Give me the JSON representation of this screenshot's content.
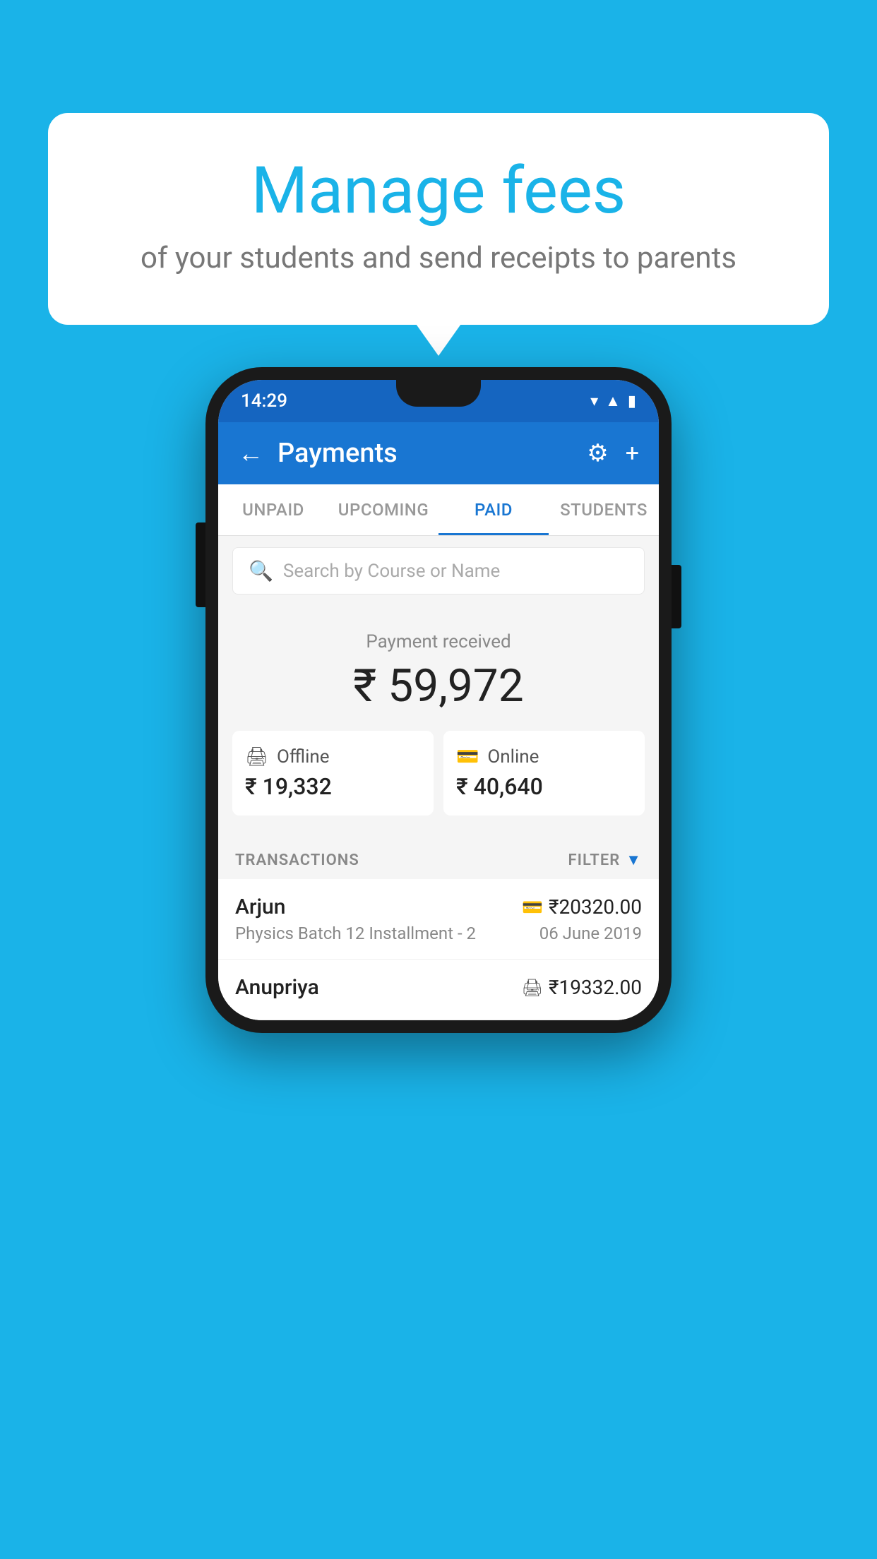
{
  "background_color": "#1ab3e8",
  "bubble": {
    "title": "Manage fees",
    "subtitle": "of your students and send receipts to parents"
  },
  "status_bar": {
    "time": "14:29",
    "icons": [
      "wifi",
      "signal",
      "battery"
    ]
  },
  "header": {
    "title": "Payments",
    "back_label": "←",
    "settings_label": "⚙",
    "add_label": "+"
  },
  "tabs": [
    {
      "label": "UNPAID",
      "active": false
    },
    {
      "label": "UPCOMING",
      "active": false
    },
    {
      "label": "PAID",
      "active": true
    },
    {
      "label": "STUDENTS",
      "active": false
    }
  ],
  "search": {
    "placeholder": "Search by Course or Name"
  },
  "payment_summary": {
    "label": "Payment received",
    "total": "₹ 59,972",
    "offline": {
      "type": "Offline",
      "amount": "₹ 19,332"
    },
    "online": {
      "type": "Online",
      "amount": "₹ 40,640"
    }
  },
  "transactions_header": {
    "label": "TRANSACTIONS",
    "filter_label": "FILTER"
  },
  "transactions": [
    {
      "name": "Arjun",
      "course": "Physics Batch 12 Installment - 2",
      "amount": "₹20320.00",
      "date": "06 June 2019",
      "payment_type": "online"
    },
    {
      "name": "Anupriya",
      "course": "",
      "amount": "₹19332.00",
      "date": "",
      "payment_type": "offline"
    }
  ]
}
